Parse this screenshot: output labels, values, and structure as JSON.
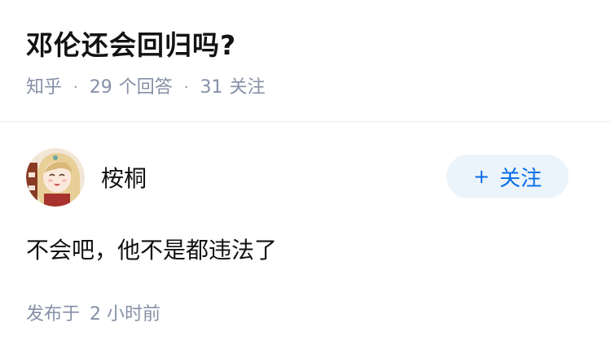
{
  "question": {
    "title": "邓伦还会回归吗?",
    "source": "知乎",
    "answer_count": "29",
    "answer_label": "个回答",
    "follow_count": "31",
    "follow_label": "关注"
  },
  "answer": {
    "author_name": "桉桐",
    "follow_button": {
      "icon": "+",
      "label": "关注"
    },
    "content": "不会吧，他不是都违法了",
    "published_prefix": "发布于",
    "published_time": "2 小时前"
  },
  "colors": {
    "title": "#121212",
    "meta": "#8590a6",
    "accent": "#056de8",
    "follow_bg": "#ebf3fb"
  }
}
